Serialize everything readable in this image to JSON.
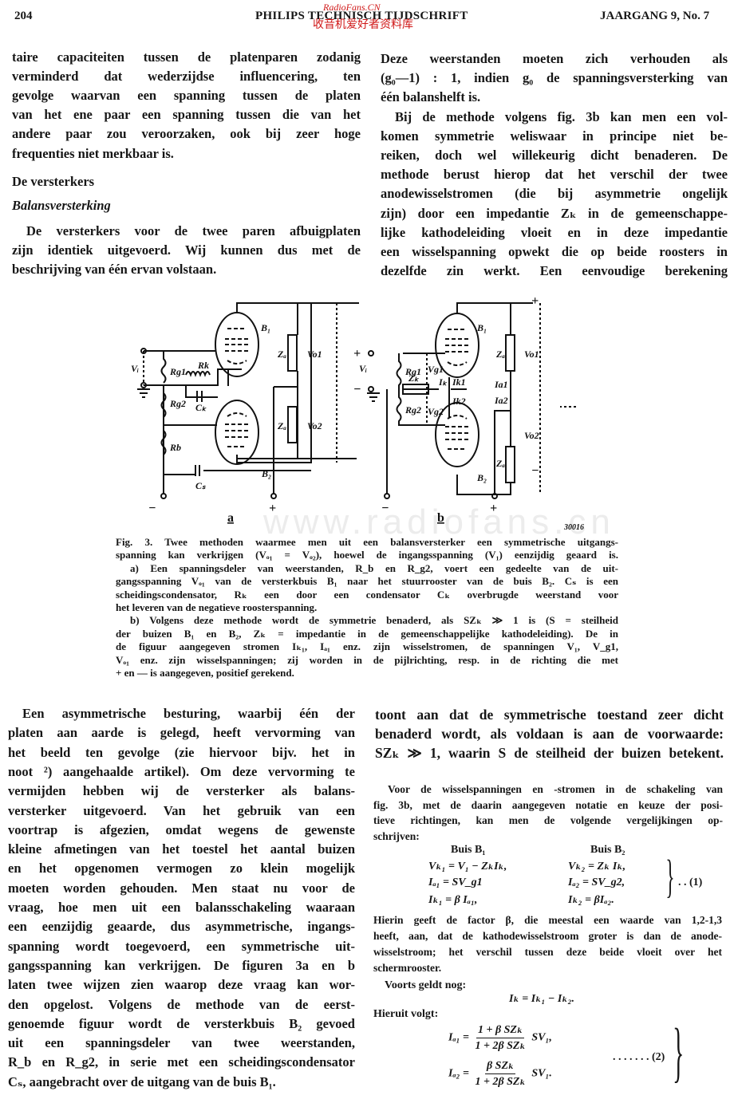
{
  "header": {
    "page_number": "204",
    "journal": "PHILIPS TECHNISCH TIJDSCHRIFT",
    "issue": "JAARGANG 9, No. 7",
    "watermark_top": "RadioFans.CN",
    "watermark_bottom": "收音机爱好者资料库"
  },
  "watermark_center": "www.radiofans.cn",
  "left_top": {
    "lines": [
      "taire capaciteiten tussen de platenparen zodanig",
      "verminderd dat wederzijdse influencering, ten",
      "gevolge waarvan een spanning tussen de platen",
      "van het ene paar een spanning tussen die van het",
      "andere paar zou veroorzaken, ook bij zeer hoge",
      "frequenties niet merkbaar is."
    ],
    "heading": "De versterkers",
    "subheading": "Balansversterking",
    "para_lines": [
      "De versterkers voor de twee paren afbuigplaten",
      "zijn identiek uitgevoerd. Wij kunnen dus met de",
      "beschrijving van één ervan volstaan."
    ]
  },
  "right_top": {
    "lines": [
      "Deze weerstanden moeten zich verhouden als",
      "(g₀—1) : 1, indien g₀ de spanningsversterking van",
      "één balanshelft is.",
      "Bij de methode volgens fig. 3b kan men een vol-",
      "komen symmetrie weliswaar in principe niet be-",
      "reiken, doch wel willekeurig dicht benaderen. De",
      "methode berust hierop dat het verschil der twee",
      "anodewisselstromen (die bij asymmetrie ongelijk",
      "zijn) door een impedantie Zₖ in de gemeenschappe-",
      "lijke kathodeleiding vloeit en in deze impedantie",
      "een wisselspanning opwekt die op beide roosters in",
      "dezelfde zin werkt. Een eenvoudige berekening"
    ]
  },
  "figure": {
    "a": {
      "B1": "B₁",
      "B2": "B₂",
      "Vi": "Vᵢ",
      "Rg1": "Rg1",
      "Rg2": "Rg2",
      "Rk": "Rk",
      "Ck": "Cₖ",
      "Rb": "Rb",
      "Cs": "Cₛ",
      "Za1": "Zₐ",
      "Za2": "Zₐ",
      "Vo1": "Vo1",
      "Vo2": "Vo2",
      "minus": "−",
      "plus": "+",
      "label": "a"
    },
    "b": {
      "B1": "B₁",
      "B2": "B₂",
      "Vi": "Vᵢ",
      "Rg1": "Rg1",
      "Rg2": "Rg2",
      "Zk": "Zₖ",
      "Vg1": "Vg1",
      "Vg2": "Vg2",
      "Ik": "Iₖ",
      "Ik1": "Ik1",
      "Ik2": "Ik2",
      "Ia1": "Ia1",
      "Ia2": "Ia2",
      "Za1": "Zₐ",
      "Za2": "Zₐ",
      "Vo1": "Vo1",
      "Vo2": "Vo2",
      "plus": "+",
      "minus": "−",
      "label": "b"
    },
    "code": "30016"
  },
  "caption": {
    "lines": [
      "Fig. 3. Twee methoden waarmee men uit een balansversterker een symmetrische uitgangs-",
      "spanning kan verkrijgen (Vₒ₁ = Vₒ₂), hoewel de ingangsspanning (V₁) eenzijdig geaard is.",
      "a) Een spanningsdeler van weerstanden, R_b en R_g2, voert een gedeelte van de uit-",
      "gangsspanning Vₒ₁ van de versterkbuis B₁ naar het stuurrooster van de buis B₂. Cₛ is een",
      "scheidingscondensator, Rₖ een door een condensator Cₖ overbrugde weerstand voor",
      "het leveren van de negatieve roosterspanning.",
      "b) Volgens deze methode wordt de symmetrie benaderd, als SZₖ ≫ 1 is (S = steilheid",
      "der buizen B₁ en B₂, Zₖ = impedantie in de gemeenschappelijke kathodeleiding). De in",
      "de figuur aangegeven stromen Iₖ₁, Iₐ₁ enz. zijn wisselstromen, de spanningen V₁, V_g1,",
      "Vₒ₁ enz. zijn wisselspanningen; zij worden in de pijlrichting, resp. in de richting die met",
      "+ en — is aangegeven, positief gerekend."
    ]
  },
  "left_bottom": {
    "lines": [
      "Een asymmetrische besturing, waarbij één der",
      "platen aan aarde is gelegd, heeft vervorming van",
      "het beeld ten gevolge (zie hiervoor bijv. het in",
      "noot ²) aangehaalde artikel). Om deze vervorming te",
      "vermijden hebben wij de versterker als balans-",
      "versterker uitgevoerd. Van het gebruik van een",
      "voortrap is afgezien, omdat wegens de gewenste",
      "kleine afmetingen van het toestel het aantal buizen",
      "en het opgenomen vermogen zo klein mogelijk",
      "moeten worden gehouden. Men staat nu voor de",
      "vraag, hoe men uit een balansschakeling waaraan",
      "een eenzijdig geaarde, dus asymmetrische, ingangs-",
      "spanning wordt toegevoerd, een symmetrische uit-",
      "gangsspanning kan verkrijgen. De figuren 3a en b",
      "laten twee wijzen zien waarop deze vraag kan wor-",
      "den opgelost. Volgens de methode van de eerst-",
      "genoemde figuur wordt de versterkbuis B₂ gevoed",
      "uit een spanningsdeler van twee weerstanden,",
      "R_b en R_g2, in serie met een scheidingscondensator",
      "Cₛ, aangebracht over de uitgang van de buis B₁."
    ]
  },
  "right_bottom": {
    "big_lines": [
      "toont aan dat de symmetrische toestand zeer dicht",
      "benaderd wordt, als voldaan is aan de voorwaarde:",
      "SZₖ ≫ 1, waarin S de steilheid der buizen betekent."
    ],
    "intro_lines": [
      "Voor de wisselspanningen en -stromen in de schakeling van",
      "fig. 3b, met de daarin aangegeven notatie en keuze der posi-",
      "tieve richtingen, kan men de volgende vergelijkingen op-",
      "schrijven:"
    ],
    "eq1": {
      "head_b1": "Buis B₁",
      "head_b2": "Buis B₂",
      "b1": [
        "Vₖ₁ = V₁ − ZₖIₖ,",
        "Iₐ₁ = SV_g1",
        "Iₖ₁ = β Iₐ₁,"
      ],
      "b2": [
        "Vₖ₂ = Zₖ Iₖ,",
        "Iₐ₂ = SV_g2,",
        "Iₖ₂ = βIₐ₂."
      ],
      "brace": "}",
      "number": ". .  (1)"
    },
    "hierin_lines": [
      "Hierin geeft de factor β, die meestal een waarde van 1,2-1,3",
      "heeft, aan, dat de kathodewisselstroom groter is dan de anode-",
      "wisselstroom; het verschil tussen deze beide vloeit over het",
      "schermrooster."
    ],
    "voorts": "Voorts geldt nog:",
    "ik_eq": "Iₖ = Iₖ₁ − Iₖ₂.",
    "hieruit": "Hieruit volgt:",
    "eq2": {
      "ia1_lhs": "Iₐ₁ =",
      "ia1_num": "1 + β SZₖ",
      "ia1_den": "1 + 2β SZₖ",
      "ia1_tail": "SV₁,",
      "ia2_lhs": "Iₐ₂ =",
      "ia2_num": "β SZₖ",
      "ia2_den": "1 + 2β SZₖ",
      "ia2_tail": "SV₁.",
      "brace": "}",
      "number": ". . . . . . .   (2)"
    }
  }
}
